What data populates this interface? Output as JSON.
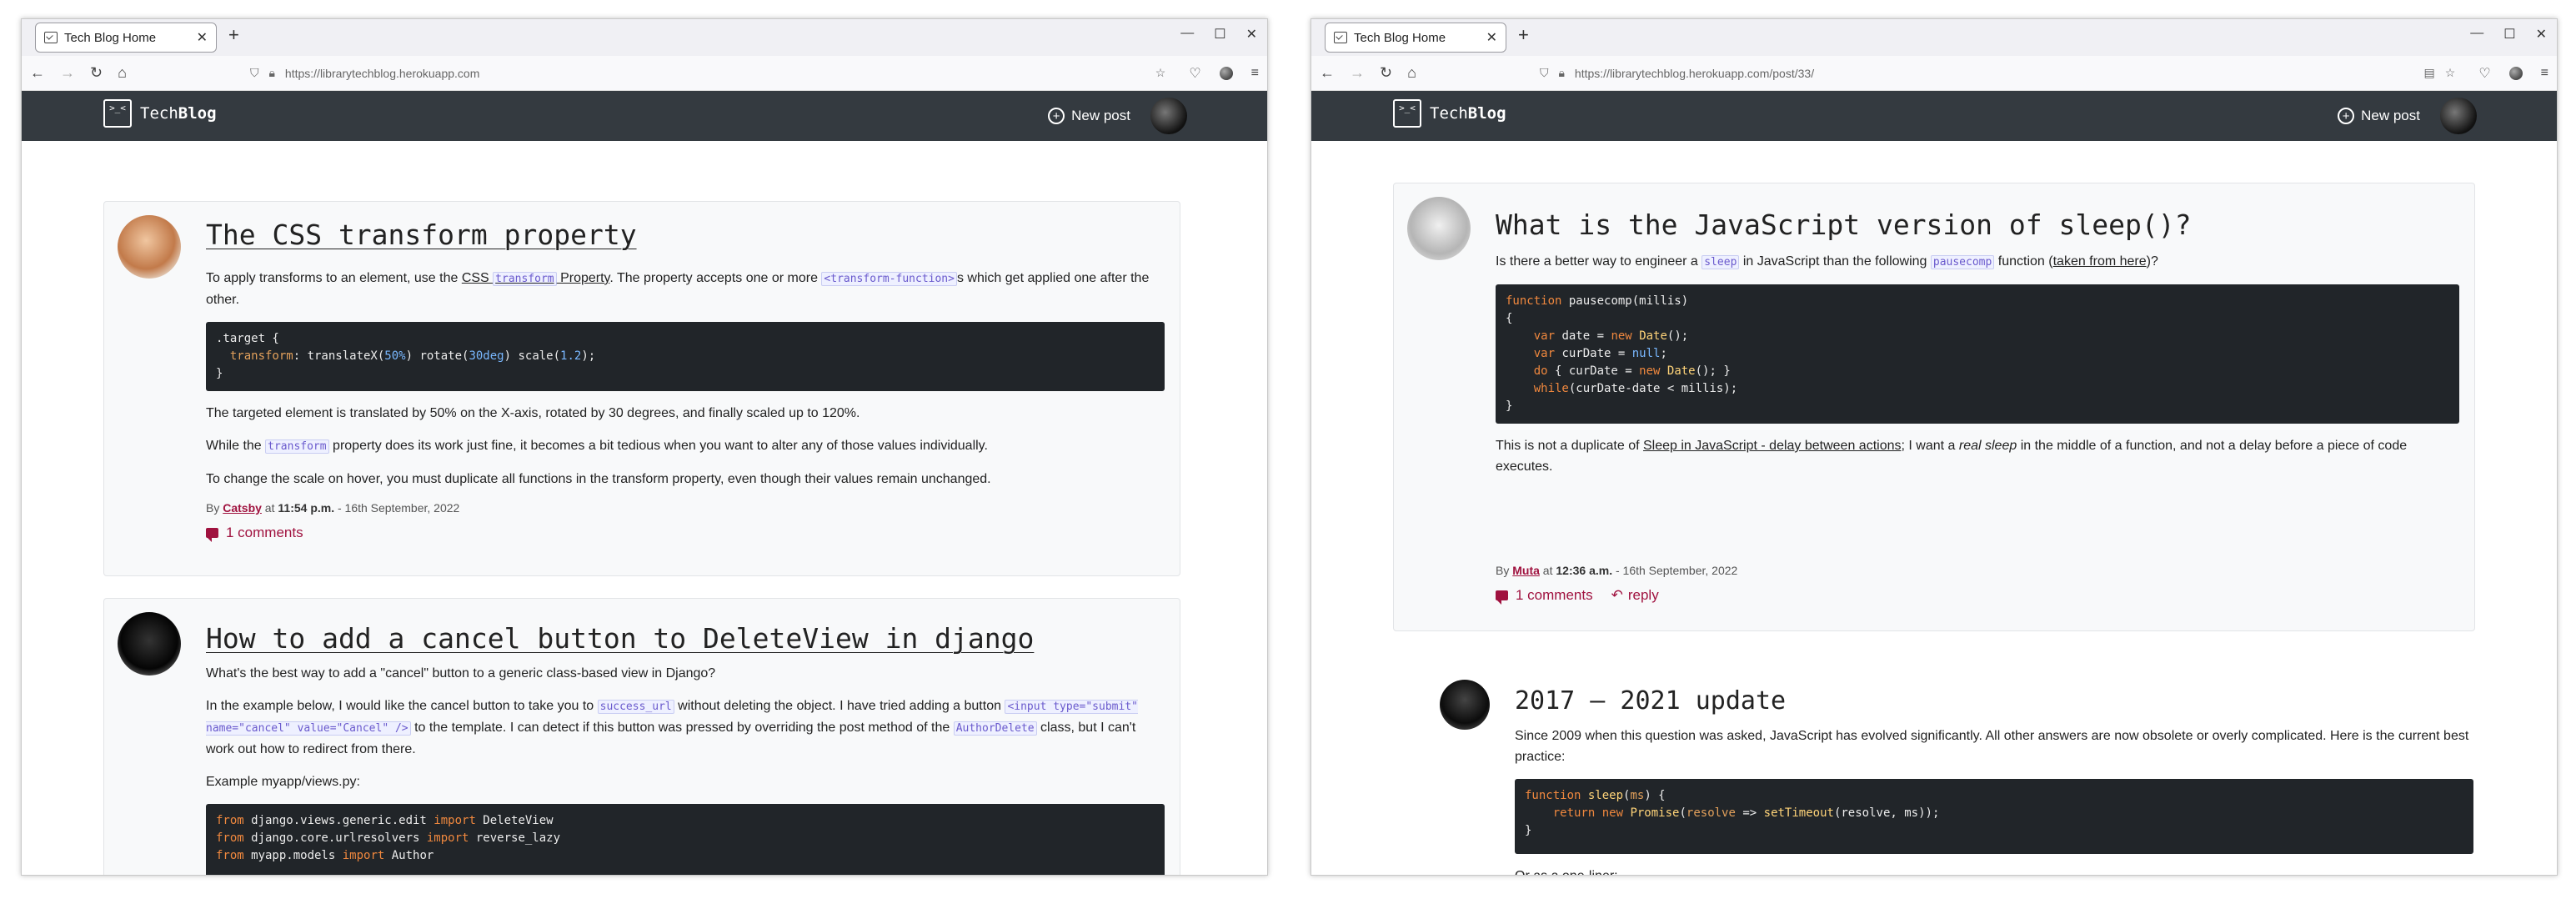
{
  "left": {
    "tab_title": "Tech Blog Home",
    "url": "https://librarytechblog.herokuapp.com",
    "site": {
      "logo_mark": ">_<",
      "brand_a": "Tech",
      "brand_b": "Blog",
      "new_post": "New post"
    },
    "post1": {
      "title": "The CSS transform property",
      "p1_a": "To apply transforms to an element, use the ",
      "p1_link_a": "CSS ",
      "p1_code": "transform",
      "p1_link_b": " Property",
      "p1_b": ". The property accepts one or more ",
      "p1_code2": "<transform-function>",
      "p1_c": "s which get applied one after the other.",
      "code": {
        "selector": ".target {",
        "prop": "transform",
        "v1": "translateX(",
        "n1": "50%",
        "v2": ") rotate(",
        "n2": "30deg",
        "v3": ") scale(",
        "n3": "1.2",
        "v4": ");",
        "close": "}"
      },
      "p2": "The targeted element is translated by 50% on the X-axis, rotated by 30 degrees, and finally scaled up to 120%.",
      "p3_a": "While the ",
      "p3_code": "transform",
      "p3_b": " property does its work just fine, it becomes a bit tedious when you want to alter any of those values individually.",
      "p4": "To change the scale on hover, you must duplicate all functions in the transform property, even though their values remain unchanged.",
      "by": "By ",
      "author": "Catsby",
      "at": " at ",
      "time": "11:54 p.m.",
      "date": " - 16th September, 2022",
      "comments": "1 comments"
    },
    "post2": {
      "title": "How to add a cancel button to DeleteView in django",
      "p1": "What's the best way to add a \"cancel\" button to a generic class-based view in Django?",
      "p2_a": "In the example below, I would like the cancel button to take you to ",
      "p2_code": "success_url",
      "p2_b": " without deleting the object. I have tried adding a button ",
      "p2_code2": "<input type=\"submit\" name=\"cancel\" value=\"Cancel\" />",
      "p2_c": " to the template. I can detect if this button was pressed by overriding the post method of the ",
      "p2_code3": "AuthorDelete",
      "p2_d": " class, but I can't work out how to redirect from there.",
      "p3": "Example myapp/views.py:",
      "code": [
        {
          "kw": "from",
          "a": " django.views.generic.edit ",
          "kw2": "import",
          "b": " DeleteView"
        },
        {
          "kw": "from",
          "a": " django.core.urlresolvers ",
          "kw2": "import",
          "b": " reverse_lazy"
        },
        {
          "kw": "from",
          "a": " myapp.models ",
          "kw2": "import",
          "b": " Author"
        }
      ]
    }
  },
  "right": {
    "tab_title": "Tech Blog Home",
    "url": "https://librarytechblog.herokuapp.com/post/33/",
    "site": {
      "logo_mark": ">_<",
      "brand_a": "Tech",
      "brand_b": "Blog",
      "new_post": "New post"
    },
    "post": {
      "title": "What is the JavaScript version of sleep()?",
      "p1_a": "Is there a better way to engineer a ",
      "p1_code": "sleep",
      "p1_b": " in JavaScript than the following ",
      "p1_code2": "pausecomp",
      "p1_c": " function (",
      "p1_link": "taken from here",
      "p1_d": ")?",
      "code": [
        "function pausecomp(millis)",
        "{",
        "    var date = new Date();",
        "    var curDate = null;",
        "    do { curDate = new Date(); }",
        "    while(curDate-date < millis);",
        "}"
      ],
      "p2_a": "This is not a duplicate of ",
      "p2_link": "Sleep in JavaScript - delay between actions",
      "p2_b": "; I want a ",
      "p2_em": "real sleep",
      "p2_c": " in the middle of a function, and not a delay before a piece of code executes.",
      "by": "By ",
      "author": "Muta",
      "at": " at ",
      "time": "12:36 a.m.",
      "date": " - 16th September, 2022",
      "comments": "1 comments",
      "reply": "reply"
    },
    "answer": {
      "title": "2017 — 2021 update",
      "p1": "Since 2009 when this question was asked, JavaScript has evolved significantly. All other answers are now obsolete or overly complicated. Here is the current best practice:",
      "code": [
        "function sleep(ms) {",
        "    return new Promise(resolve => setTimeout(resolve, ms));",
        "}"
      ],
      "p2": "Or as a one-liner:"
    }
  }
}
